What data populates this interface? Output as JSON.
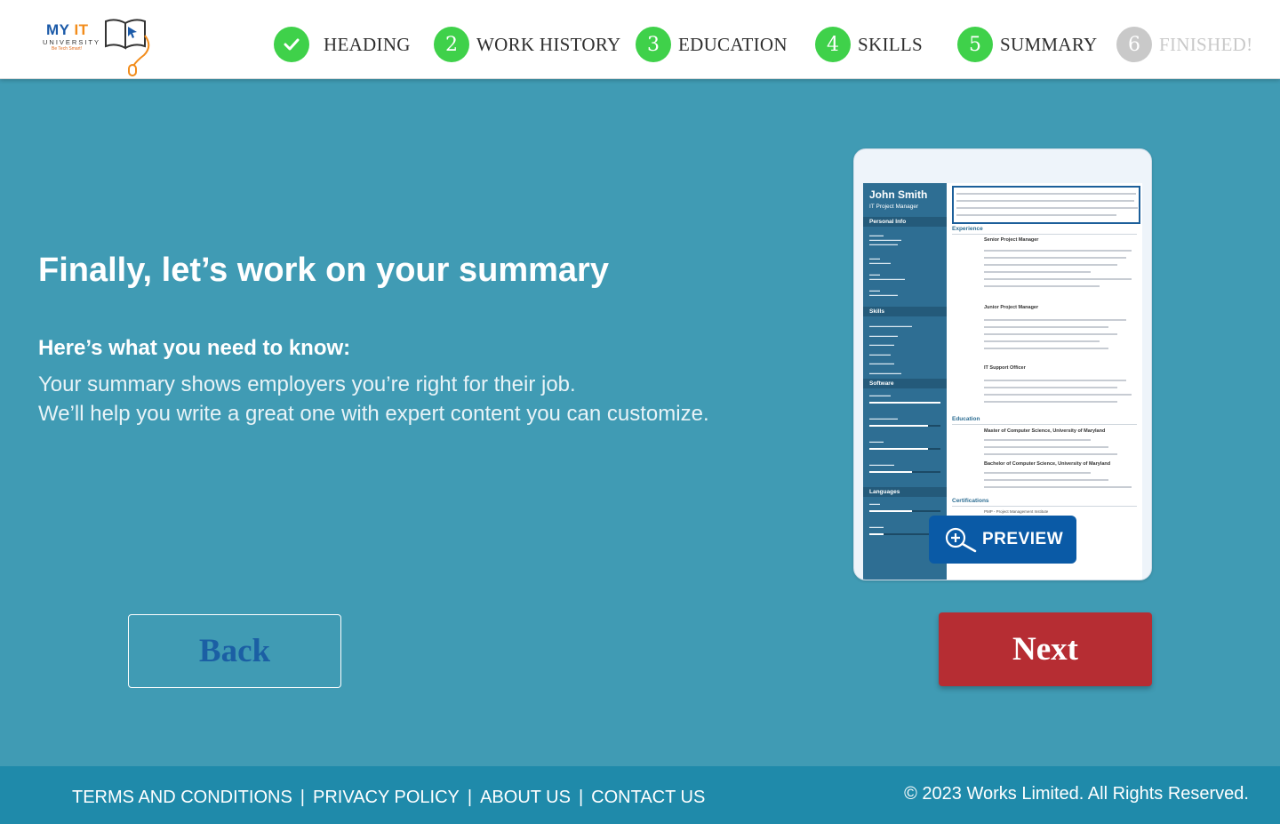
{
  "logo": {
    "brand_my": "MY",
    "brand_it": "IT",
    "university": "UNIVERSITY",
    "tagline": "Be Tech Smart!"
  },
  "steps": [
    {
      "number": "✓",
      "label": "HEADING",
      "status": "done"
    },
    {
      "number": "2",
      "label": "WORK HISTORY",
      "status": "done"
    },
    {
      "number": "3",
      "label": "EDUCATION",
      "status": "done"
    },
    {
      "number": "4",
      "label": "SKILLS",
      "status": "done"
    },
    {
      "number": "5",
      "label": "SUMMARY",
      "status": "current"
    },
    {
      "number": "6",
      "label": "FINISHED!",
      "status": "pending"
    }
  ],
  "main": {
    "title": "Finally, let’s work on your summary",
    "subtitle": "Here’s what you need to know:",
    "line1": "Your summary shows employers you’re right for their job.",
    "line2": "We’ll help you write a great one with expert content you can customize."
  },
  "resume": {
    "name": "John Smith",
    "role": "IT Project Manager",
    "personal_info": "Personal Info",
    "skills": "Skills",
    "software": "Software",
    "languages": "Languages",
    "experience": "Experience",
    "education": "Education",
    "certifications": "Certifications",
    "job1": "Senior Project Manager",
    "job2": "Junior Project Manager",
    "job3": "IT Support Officer",
    "edu1": "Master of Computer Science, University of Maryland",
    "edu2": "Bachelor of Computer Science, University of Maryland",
    "cert1": "PMP - Project Management Institute"
  },
  "preview_button": "PREVIEW",
  "buttons": {
    "back": "Back",
    "next": "Next"
  },
  "footer": {
    "links": [
      "TERMS AND CONDITIONS",
      "PRIVACY POLICY",
      "ABOUT US",
      "CONTACT US"
    ],
    "separator": "|",
    "copyright": "© 2023 Works Limited. All Rights Reserved."
  },
  "colors": {
    "background": "#409bb4",
    "step_active": "#3fd14a",
    "step_pending": "#c9c9c9",
    "next_button": "#b62d33",
    "preview_button": "#0a5aa6",
    "footer": "#1f8aaa"
  }
}
